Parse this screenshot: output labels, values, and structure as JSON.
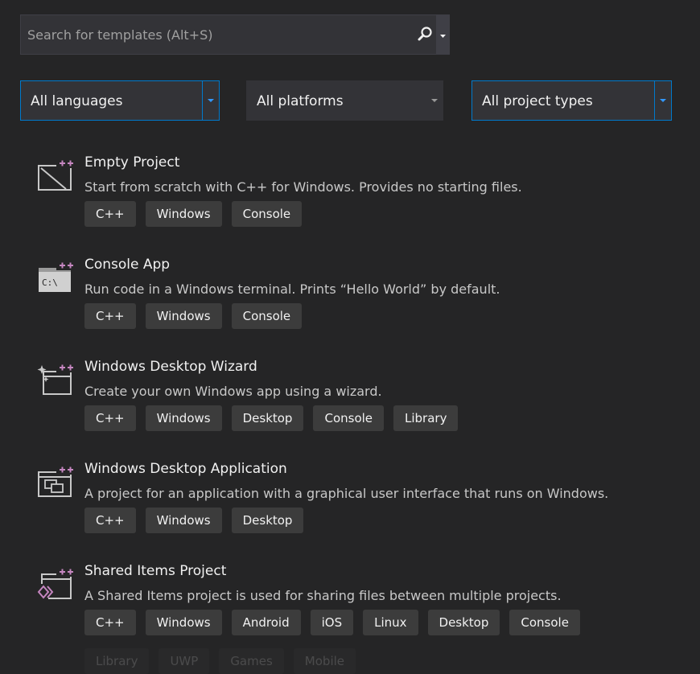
{
  "search": {
    "placeholder": "Search for templates (Alt+S)"
  },
  "filters": {
    "language": "All languages",
    "platform": "All platforms",
    "project_type": "All project types"
  },
  "templates": [
    {
      "title": "Empty Project",
      "description": "Start from scratch with C++ for Windows. Provides no starting files.",
      "tags": [
        "C++",
        "Windows",
        "Console"
      ],
      "icon": "empty-project-icon"
    },
    {
      "title": "Console App",
      "description": "Run code in a Windows terminal. Prints “Hello World” by default.",
      "tags": [
        "C++",
        "Windows",
        "Console"
      ],
      "icon": "console-app-icon"
    },
    {
      "title": "Windows Desktop Wizard",
      "description": "Create your own Windows app using a wizard.",
      "tags": [
        "C++",
        "Windows",
        "Desktop",
        "Console",
        "Library"
      ],
      "icon": "desktop-wizard-icon"
    },
    {
      "title": "Windows Desktop Application",
      "description": "A project for an application with a graphical user interface that runs on Windows.",
      "tags": [
        "C++",
        "Windows",
        "Desktop"
      ],
      "icon": "desktop-application-icon"
    },
    {
      "title": "Shared Items Project",
      "description": "A Shared Items project is used for sharing files between multiple projects.",
      "tags": [
        "C++",
        "Windows",
        "Android",
        "iOS",
        "Linux",
        "Desktop",
        "Console"
      ],
      "icon": "shared-items-icon"
    }
  ],
  "partial_tags": [
    "Library",
    "UWP",
    "Games",
    "Mobile"
  ],
  "colors": {
    "background": "#252526",
    "accent": "#007acc",
    "plus": "#c586c0",
    "tag_bg": "#3c3c3c"
  }
}
